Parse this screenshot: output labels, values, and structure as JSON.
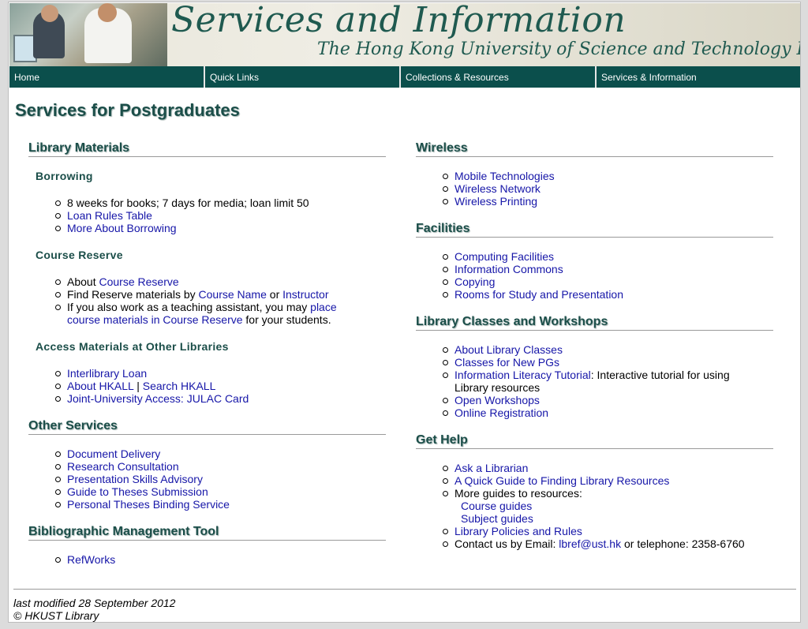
{
  "banner": {
    "title": "Services and Information",
    "subtitle": "The Hong Kong University of Science and Technology Library"
  },
  "nav": {
    "items": [
      {
        "label": "Home"
      },
      {
        "label": "Quick Links"
      },
      {
        "label": "Collections & Resources"
      },
      {
        "label": "Services & Information"
      }
    ]
  },
  "page_title": "Services for Postgraduates",
  "left": {
    "library_materials": {
      "heading": "Library Materials",
      "borrowing": {
        "heading": "Borrowing",
        "item1": "8 weeks for books; 7 days for media; loan limit 50",
        "item2": "Loan Rules Table",
        "item3": "More About Borrowing"
      },
      "course_reserve": {
        "heading": "Course Reserve",
        "about_prefix": "About ",
        "about_link": "Course Reserve",
        "find_prefix": "Find Reserve materials by ",
        "course_name": "Course Name",
        "or": " or ",
        "instructor": "Instructor",
        "ta_prefix": "If you also work as a teaching assistant, you may ",
        "ta_link": "place course materials in Course Reserve",
        "ta_suffix": " for your students."
      },
      "other_libraries": {
        "heading": "Access Materials at Other Libraries",
        "interlibrary": "Interlibrary Loan",
        "about_hkall": "About HKALL",
        "sep": " | ",
        "search_hkall": "Search HKALL",
        "julac": "Joint-University Access: JULAC Card"
      }
    },
    "other_services": {
      "heading": "Other Services",
      "items": [
        "Document Delivery",
        "Research Consultation",
        "Presentation Skills Advisory",
        "Guide to Theses Submission",
        "Personal Theses Binding Service"
      ]
    },
    "biblio": {
      "heading": "Bibliographic Management Tool",
      "items": [
        "RefWorks"
      ]
    }
  },
  "right": {
    "wireless": {
      "heading": "Wireless",
      "items": [
        "Mobile Technologies",
        "Wireless Network",
        "Wireless Printing"
      ]
    },
    "facilities": {
      "heading": "Facilities",
      "items": [
        "Computing Facilities",
        "Information Commons",
        "Copying",
        "Rooms for Study and Presentation"
      ]
    },
    "classes": {
      "heading": "Library Classes and Workshops",
      "about": "About Library Classes",
      "new_pgs": "Classes for New PGs",
      "tutorial_link": "Information Literacy Tutorial",
      "tutorial_text": ": Interactive tutorial for using Library resources",
      "open_workshops": "Open Workshops",
      "online_reg": "Online Registration"
    },
    "help": {
      "heading": "Get Help",
      "ask": "Ask a Librarian",
      "quick_guide": "A Quick Guide to Finding Library Resources",
      "more_guides": "More guides to resources:",
      "course_guides": "Course guides",
      "subject_guides": "Subject guides",
      "policies": "Library Policies and Rules",
      "contact_prefix": "Contact us by Email: ",
      "email": "lbref@ust.hk",
      "contact_suffix": " or telephone: 2358-6760"
    }
  },
  "footer": {
    "modified": "last modified 28 September 2012",
    "copyright": "© HKUST Library"
  }
}
